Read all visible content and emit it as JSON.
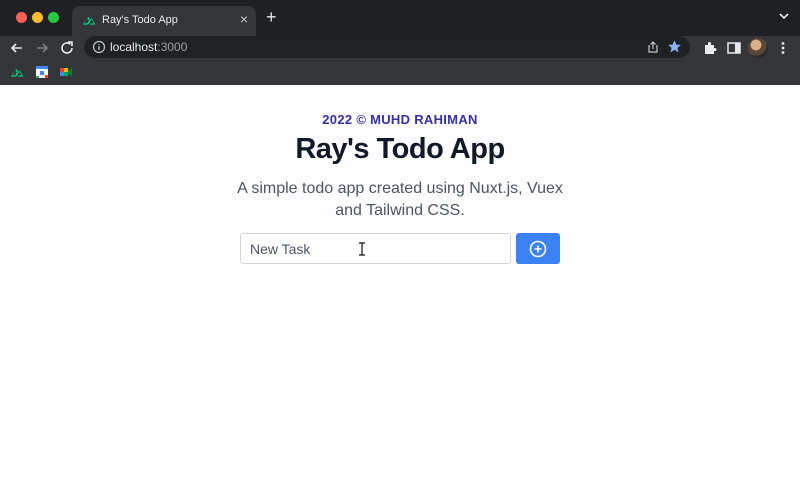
{
  "browser": {
    "tab": {
      "title": "Ray's Todo App",
      "close": "×"
    },
    "new_tab": "+",
    "address": {
      "host": "localhost",
      "port": ":3000"
    }
  },
  "app": {
    "credit": "2022 © MUHD RAHIMAN",
    "title": "Ray's Todo App",
    "description": "A simple todo app created using Nuxt.js, Vuex and Tailwind CSS.",
    "task_input": {
      "placeholder": "New Task",
      "value": ""
    }
  },
  "colors": {
    "accent": "#3b82f6",
    "credit": "#3730a3",
    "title": "#111827",
    "nuxt_green": "#00dc82"
  }
}
